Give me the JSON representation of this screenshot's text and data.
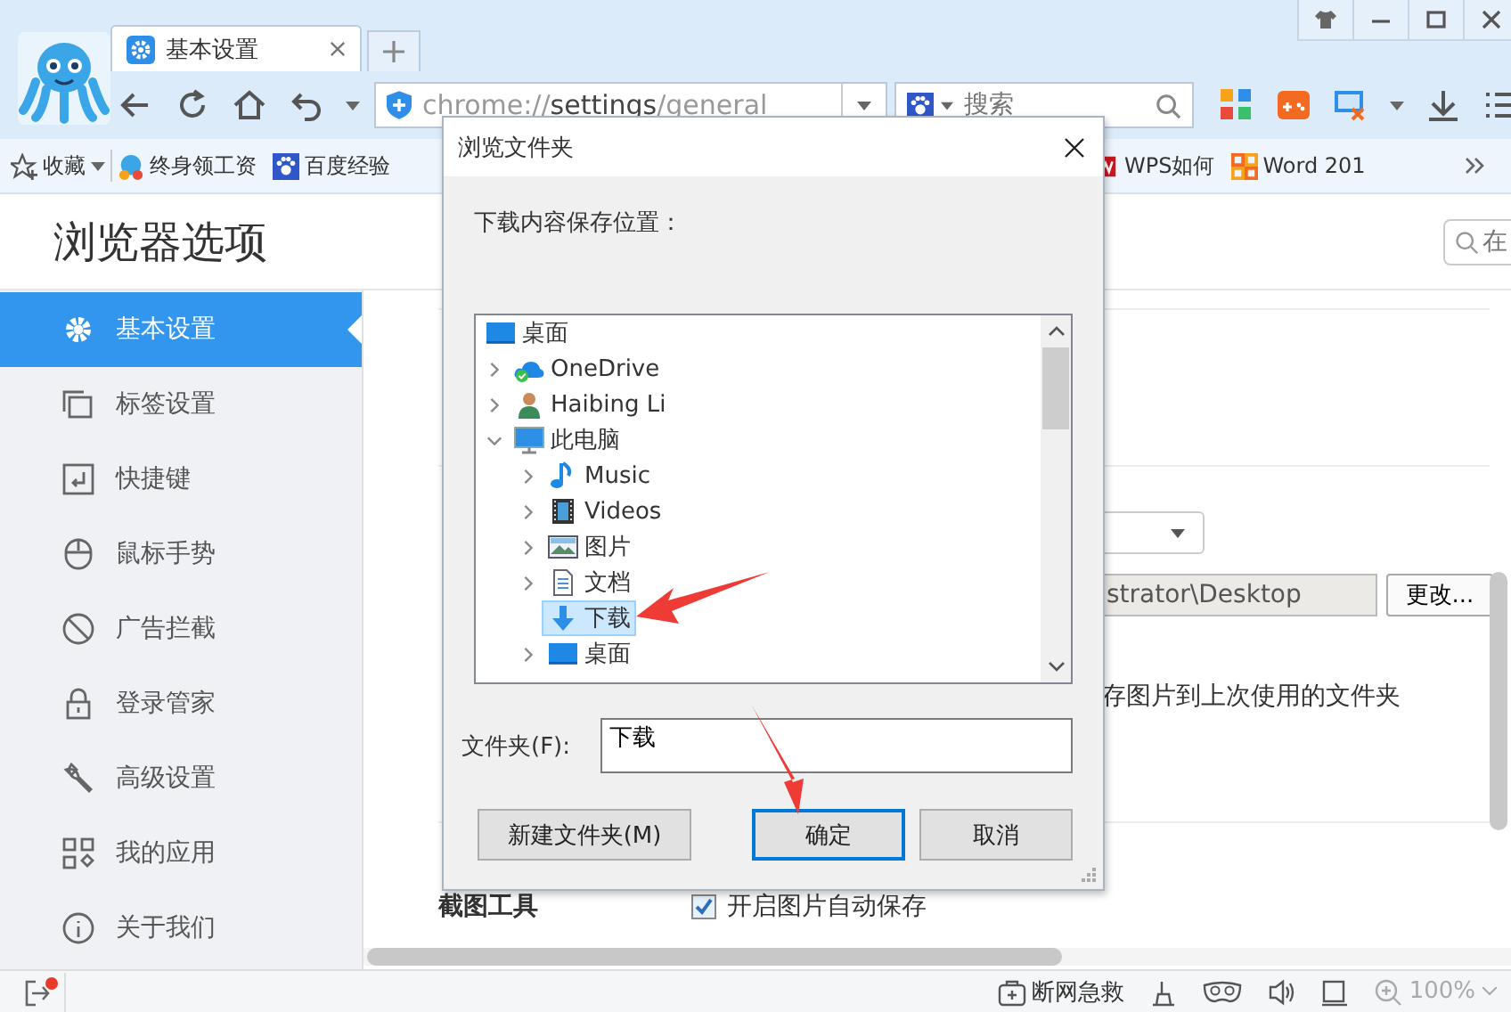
{
  "tabs": [
    {
      "label": "基本设置",
      "selected": true
    }
  ],
  "address_bar": {
    "url": "chrome://**settings**/general"
  },
  "search": {
    "placeholder": "搜索"
  },
  "bookmarks": [
    {
      "label": "收藏",
      "kind": "favorites"
    },
    {
      "label": "终身领工资",
      "kind": "gift"
    },
    {
      "label": "百度经验",
      "kind": "paw"
    },
    {
      "label": "WPS如何",
      "kind": "wps"
    },
    {
      "label": "Word 201",
      "kind": "word"
    }
  ],
  "page": {
    "title": "浏览器选项",
    "search_placeholder": "在"
  },
  "sidebar": {
    "items": [
      {
        "label": "基本设置",
        "kind": "gear",
        "selected": true
      },
      {
        "label": "标签设置",
        "kind": "tabs",
        "selected": false
      },
      {
        "label": "快捷键",
        "kind": "key",
        "selected": false
      },
      {
        "label": "鼠标手势",
        "kind": "mouse",
        "selected": false
      },
      {
        "label": "广告拦截",
        "kind": "block",
        "selected": false
      },
      {
        "label": "登录管家",
        "kind": "lock",
        "selected": false
      },
      {
        "label": "高级设置",
        "kind": "wrench",
        "selected": false
      },
      {
        "label": "我的应用",
        "kind": "apps",
        "selected": false
      },
      {
        "label": "关于我们",
        "kind": "info",
        "selected": false
      }
    ]
  },
  "content": {
    "path_field": {
      "value": "strator\\Desktop"
    },
    "change_button": "更改...",
    "image_option": "存图片到上次使用的文件夹",
    "screenshot": {
      "label": "截图工具",
      "auto_save": {
        "label": "开启图片自动保存",
        "checked": true
      }
    }
  },
  "dialog": {
    "title": "浏览文件夹",
    "prompt": "下载内容保存位置：",
    "tree": [
      {
        "label": "桌面",
        "kind": "desktop",
        "expandable": false,
        "selected": false,
        "children": [
          {
            "label": "OneDrive",
            "kind": "cloud",
            "expandable": true,
            "expanded": false,
            "selected": false
          },
          {
            "label": "Haibing Li",
            "kind": "user",
            "expandable": true,
            "expanded": false,
            "selected": false
          },
          {
            "label": "此电脑",
            "kind": "computer",
            "expandable": true,
            "expanded": true,
            "selected": false,
            "children": [
              {
                "label": "Music",
                "kind": "music",
                "expandable": true,
                "expanded": false,
                "selected": false
              },
              {
                "label": "Videos",
                "kind": "video",
                "expandable": true,
                "expanded": false,
                "selected": false
              },
              {
                "label": "图片",
                "kind": "picture",
                "expandable": true,
                "expanded": false,
                "selected": false
              },
              {
                "label": "文档",
                "kind": "document",
                "expandable": true,
                "expanded": false,
                "selected": false
              },
              {
                "label": "下载",
                "kind": "download",
                "expandable": false,
                "selected": true
              },
              {
                "label": "桌面",
                "kind": "desktop",
                "expandable": true,
                "expanded": false,
                "selected": false
              }
            ]
          }
        ]
      }
    ],
    "folder_label": "文件夹(F):",
    "folder_value": "下载",
    "buttons": [
      {
        "label": "新建文件夹(M)",
        "default": false
      },
      {
        "label": "确定",
        "default": true
      },
      {
        "label": "取消",
        "default": false
      }
    ]
  },
  "status_bar": {
    "rescue": "断网急救",
    "zoom": "100%"
  }
}
